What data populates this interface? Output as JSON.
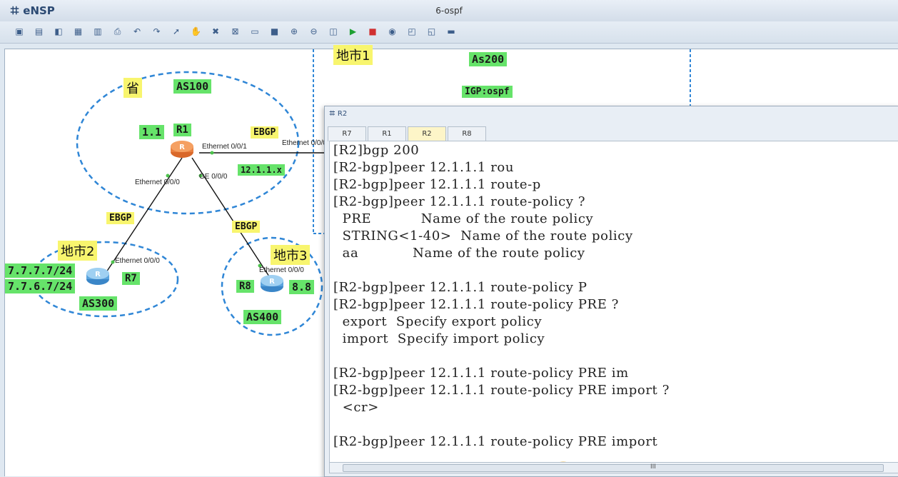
{
  "app": {
    "logo": "eNSP",
    "title": "6-ospf"
  },
  "toolbar": {
    "icons": [
      "new-topo-icon",
      "new-topo2-icon",
      "open-icon",
      "save-icon",
      "save-as-icon",
      "print-icon",
      "undo-icon",
      "redo-icon",
      "select-icon",
      "hand-icon",
      "delete-icon",
      "delete-link-icon",
      "text-icon",
      "palette-icon",
      "zoom-in-icon",
      "zoom-out-icon",
      "fit-icon",
      "start-icon",
      "stop-icon",
      "capture-icon",
      "topo-icon",
      "settings-icon",
      "console-icon"
    ]
  },
  "topology": {
    "area_province": {
      "cn": "省",
      "as": "AS100"
    },
    "area_city1": {
      "cn": "地市1",
      "as": "As200",
      "igp": "IGP:ospf"
    },
    "area_city2": {
      "cn": "地市2",
      "as": "AS300",
      "net1": "7.7.7.7/24",
      "net2": "7.7.6.7/24"
    },
    "area_city3": {
      "cn": "地市3",
      "as": "AS400"
    },
    "r1": {
      "name": "R1",
      "addr": "1.1"
    },
    "r7": {
      "name": "R7"
    },
    "r8": {
      "name": "R8",
      "addr": "8.8"
    },
    "links": {
      "ebgp_r1_r2": "EBGP",
      "ebgp_r1_r7": "EBGP",
      "ebgp_r1_r8": "EBGP",
      "subnet": "12.1.1.x"
    },
    "ports": {
      "r1_eth001": "Ethernet 0/0/1",
      "r1_eth000": "Ethernet 0/0/0",
      "r1_ge000": "GE 0/0/0",
      "r2_eth000": "Ethernet 0/0/0",
      "r7_eth000": "Ethernet 0/0/0",
      "r8_eth000": "Ethernet 0/0/0"
    }
  },
  "console": {
    "title": "R2",
    "tabs": [
      "R7",
      "R1",
      "R2",
      "R8"
    ],
    "active_tab": "R2",
    "lines": [
      "[R2]bgp 200",
      "[R2-bgp]peer 12.1.1.1 rou",
      "[R2-bgp]peer 12.1.1.1 route-p",
      "[R2-bgp]peer 12.1.1.1 route-policy ?",
      "  PRE           Name of the route policy",
      "  STRING<1-40>  Name of the route policy",
      "  aa            Name of the route policy",
      "",
      "[R2-bgp]peer 12.1.1.1 route-policy P",
      "[R2-bgp]peer 12.1.1.1 route-policy PRE ?",
      "  export  Specify export policy",
      "  import  Specify import policy",
      "",
      "[R2-bgp]peer 12.1.1.1 route-policy PRE im",
      "[R2-bgp]peer 12.1.1.1 route-policy PRE import ?",
      "  <cr>",
      "",
      "[R2-bgp]peer 12.1.1.1 route-policy PRE import"
    ],
    "scroll_marker": "III"
  }
}
